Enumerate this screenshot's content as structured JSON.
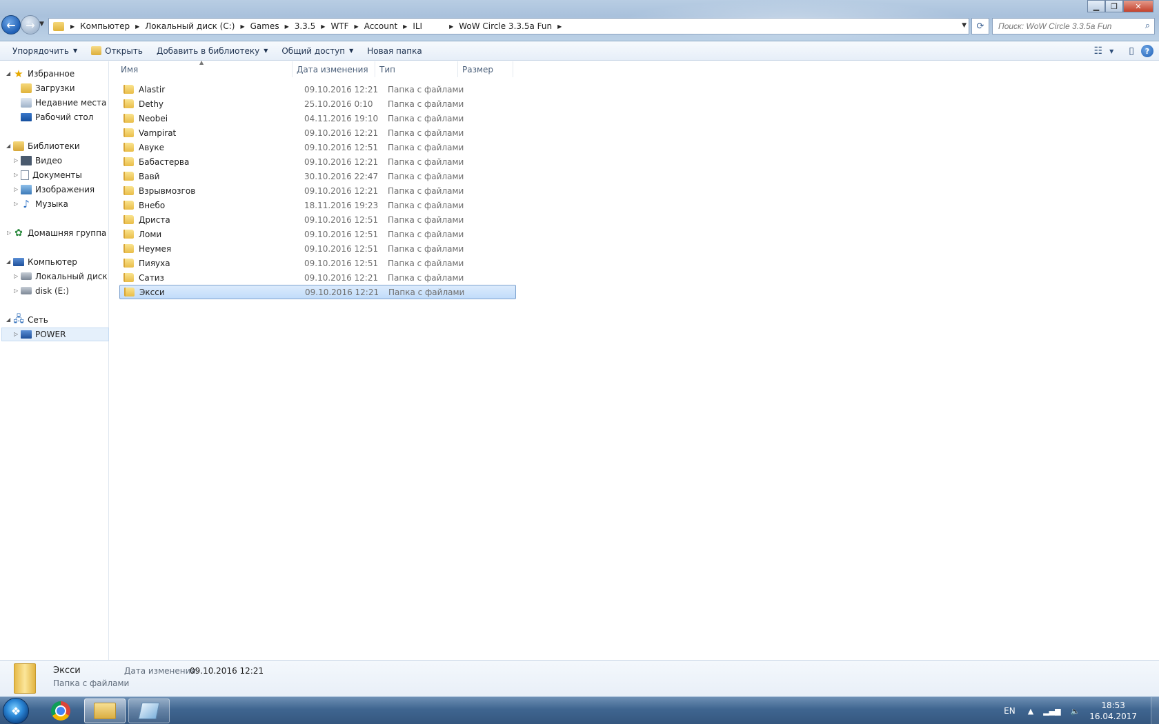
{
  "breadcrumb": [
    {
      "label": "Компьютер"
    },
    {
      "label": "Локальный диск (C:)"
    },
    {
      "label": "Games"
    },
    {
      "label": "3.3.5"
    },
    {
      "label": "WTF"
    },
    {
      "label": "Account"
    },
    {
      "label": "ILI"
    },
    {
      "label": "WoW Circle 3.3.5a Fun"
    }
  ],
  "search": {
    "placeholder": "Поиск: WoW Circle 3.3.5a Fun"
  },
  "toolbar": {
    "organize": "Упорядочить",
    "open": "Открыть",
    "add_to_library": "Добавить в библиотеку",
    "share": "Общий доступ",
    "new_folder": "Новая папка"
  },
  "nav": {
    "favorites": "Избранное",
    "downloads": "Загрузки",
    "recent": "Недавние места",
    "desktop": "Рабочий стол",
    "libraries": "Библиотеки",
    "video": "Видео",
    "documents": "Документы",
    "images": "Изображения",
    "music": "Музыка",
    "homegroup": "Домашняя группа",
    "computer": "Компьютер",
    "local_disk": "Локальный диск (C",
    "disk_e": "disk (E:)",
    "network": "Сеть",
    "power": "POWER"
  },
  "columns": {
    "name": "Имя",
    "date": "Дата изменения",
    "type": "Тип",
    "size": "Размер"
  },
  "files": [
    {
      "name": "Alastir",
      "date": "09.10.2016 12:21",
      "type": "Папка с файлами"
    },
    {
      "name": "Dethy",
      "date": "25.10.2016 0:10",
      "type": "Папка с файлами"
    },
    {
      "name": "Neobei",
      "date": "04.11.2016 19:10",
      "type": "Папка с файлами"
    },
    {
      "name": "Vampirat",
      "date": "09.10.2016 12:21",
      "type": "Папка с файлами"
    },
    {
      "name": "Авуке",
      "date": "09.10.2016 12:51",
      "type": "Папка с файлами"
    },
    {
      "name": "Бабастерва",
      "date": "09.10.2016 12:21",
      "type": "Папка с файлами"
    },
    {
      "name": "Вавй",
      "date": "30.10.2016 22:47",
      "type": "Папка с файлами"
    },
    {
      "name": "Взрывмозгов",
      "date": "09.10.2016 12:21",
      "type": "Папка с файлами"
    },
    {
      "name": "Внебо",
      "date": "18.11.2016 19:23",
      "type": "Папка с файлами"
    },
    {
      "name": "Дриста",
      "date": "09.10.2016 12:51",
      "type": "Папка с файлами"
    },
    {
      "name": "Ломи",
      "date": "09.10.2016 12:51",
      "type": "Папка с файлами"
    },
    {
      "name": "Неумея",
      "date": "09.10.2016 12:51",
      "type": "Папка с файлами"
    },
    {
      "name": "Пияуха",
      "date": "09.10.2016 12:51",
      "type": "Папка с файлами"
    },
    {
      "name": "Сатиз",
      "date": "09.10.2016 12:21",
      "type": "Папка с файлами"
    },
    {
      "name": "Эксси",
      "date": "09.10.2016 12:21",
      "type": "Папка с файлами",
      "selected": true
    }
  ],
  "details": {
    "name": "Эксси",
    "type": "Папка с файлами",
    "date_label": "Дата изменения:",
    "date": "09.10.2016 12:21"
  },
  "taskbar": {
    "lang": "EN",
    "time": "18:53",
    "date": "16.04.2017"
  },
  "icons": {
    "folder": "folder-icon",
    "back": "back-arrow-icon",
    "forward": "forward-arrow-icon",
    "search": "search-icon",
    "refresh": "refresh-icon",
    "help": "help-icon"
  }
}
